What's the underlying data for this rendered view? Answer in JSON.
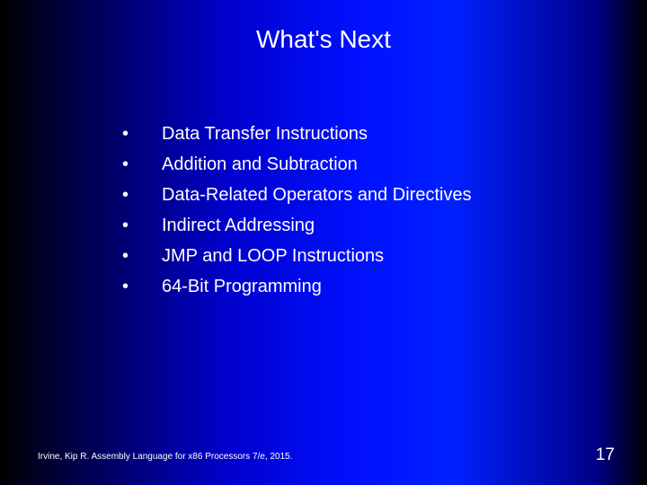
{
  "title": "What's Next",
  "bullets": {
    "b0": "Data Transfer Instructions",
    "b1": "Addition and Subtraction",
    "b2": "Data-Related Operators and Directives",
    "b3": "Indirect Addressing",
    "b4": "JMP and LOOP Instructions",
    "b5": "64-Bit Programming"
  },
  "footer": "Irvine, Kip R. Assembly Language for x86 Processors 7/e, 2015.",
  "page": "17",
  "dot": "•"
}
